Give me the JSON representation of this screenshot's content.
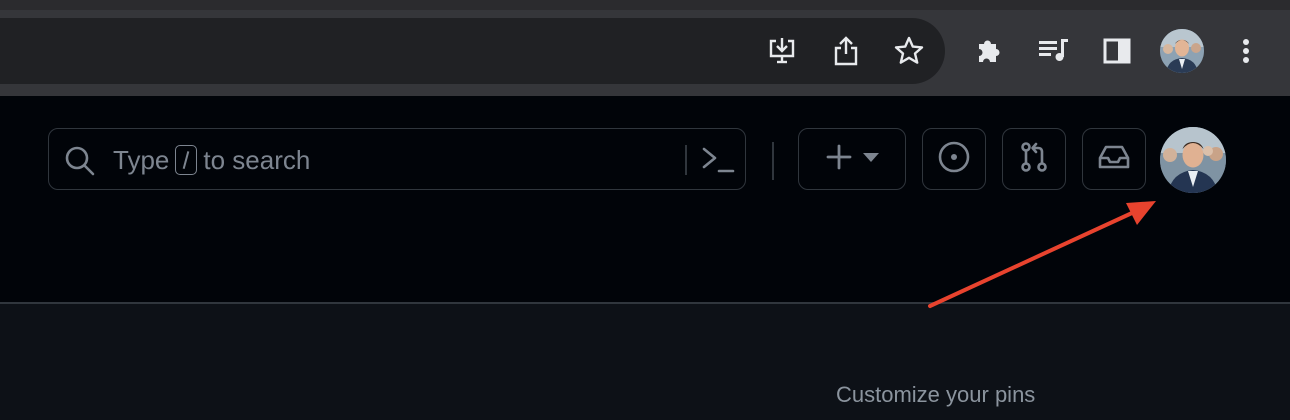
{
  "browser": {
    "icons": [
      "install-app-icon",
      "share-icon",
      "bookmark-star-icon",
      "extensions-icon",
      "reading-list-icon",
      "side-panel-icon",
      "profile-avatar",
      "kebab-menu-icon"
    ]
  },
  "github_header": {
    "search": {
      "placeholder_before": "Type",
      "placeholder_after": "to search"
    },
    "buttons": [
      "create-new-button",
      "issues-button",
      "pull-requests-button",
      "inbox-button",
      "user-avatar-button"
    ]
  },
  "main": {
    "customize_pins_label": "Customize your pins"
  },
  "colors": {
    "annotation_arrow": "#e8432e",
    "header_bg": "#010409",
    "page_bg": "#0d1117",
    "border": "#30363d",
    "muted_text": "#7d8590"
  }
}
